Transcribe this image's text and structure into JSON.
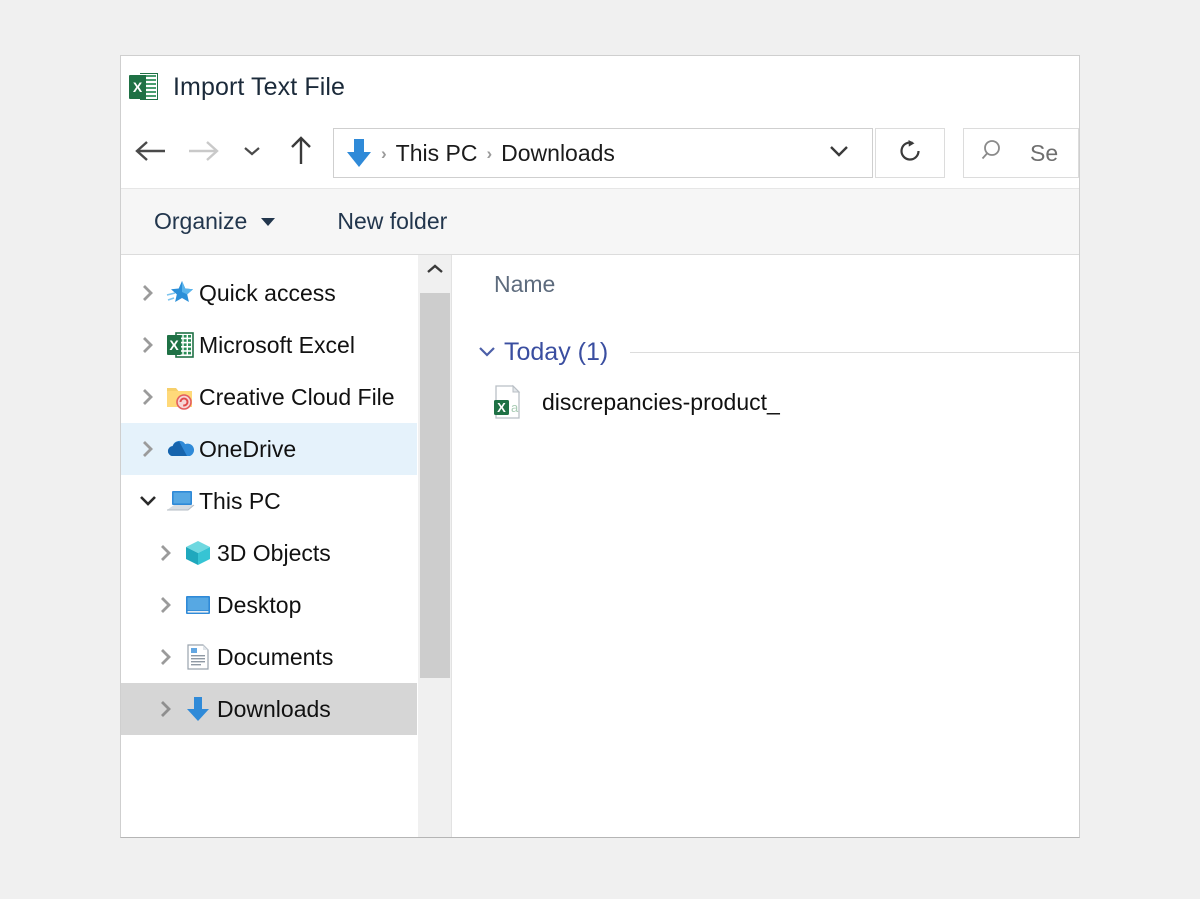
{
  "window": {
    "title": "Import Text File",
    "app_icon": "excel-icon"
  },
  "navigation": {
    "back_icon": "arrow-left-icon",
    "forward_icon": "arrow-right-icon",
    "recent_icon": "chevron-down-icon",
    "up_icon": "arrow-up-icon",
    "address": {
      "location_icon": "downloads-arrow-icon",
      "crumbs": [
        "This PC",
        "Downloads"
      ],
      "separator": "›",
      "dropdown_icon": "chevron-down-icon"
    },
    "refresh_icon": "refresh-icon",
    "search": {
      "icon": "search-icon",
      "placeholder": "Se"
    }
  },
  "toolbar": {
    "organize_label": "Organize",
    "new_folder_label": "New folder"
  },
  "sidebar": {
    "scroll_up_icon": "chevron-up-icon",
    "items": [
      {
        "label": "Quick access",
        "icon": "quick-access-star-icon",
        "expander": "chevron-right-icon",
        "indent": false,
        "state": "normal"
      },
      {
        "label": "Microsoft Excel",
        "icon": "excel-icon",
        "expander": "chevron-right-icon",
        "indent": false,
        "state": "normal"
      },
      {
        "label": "Creative Cloud File",
        "icon": "creative-cloud-folder-icon",
        "expander": "chevron-right-icon",
        "indent": false,
        "state": "normal"
      },
      {
        "label": "OneDrive",
        "icon": "onedrive-cloud-icon",
        "expander": "chevron-right-icon",
        "indent": false,
        "state": "highlighted"
      },
      {
        "label": "This PC",
        "icon": "this-pc-icon",
        "expander": "chevron-down-icon",
        "indent": false,
        "state": "normal"
      },
      {
        "label": "3D Objects",
        "icon": "3d-objects-icon",
        "expander": "chevron-right-icon",
        "indent": true,
        "state": "normal"
      },
      {
        "label": "Desktop",
        "icon": "desktop-icon",
        "expander": "chevron-right-icon",
        "indent": true,
        "state": "normal"
      },
      {
        "label": "Documents",
        "icon": "documents-icon",
        "expander": "chevron-right-icon",
        "indent": true,
        "state": "normal"
      },
      {
        "label": "Downloads",
        "icon": "downloads-arrow-icon",
        "expander": "chevron-right-icon",
        "indent": true,
        "state": "selected"
      }
    ]
  },
  "filelist": {
    "columns": [
      "Name"
    ],
    "groups": [
      {
        "title": "Today (1)",
        "collapse_icon": "chevron-down-icon",
        "files": [
          {
            "name": "discrepancies-product_",
            "icon": "csv-file-icon"
          }
        ]
      }
    ]
  },
  "colors": {
    "accent_blue": "#2f8ad8",
    "excel_green": "#1f7145",
    "group_header_blue": "#3a4ea0",
    "selection_gray": "#d6d6d6",
    "highlight_blue": "#e5f2fb",
    "page_background": "#f0f0f0"
  }
}
